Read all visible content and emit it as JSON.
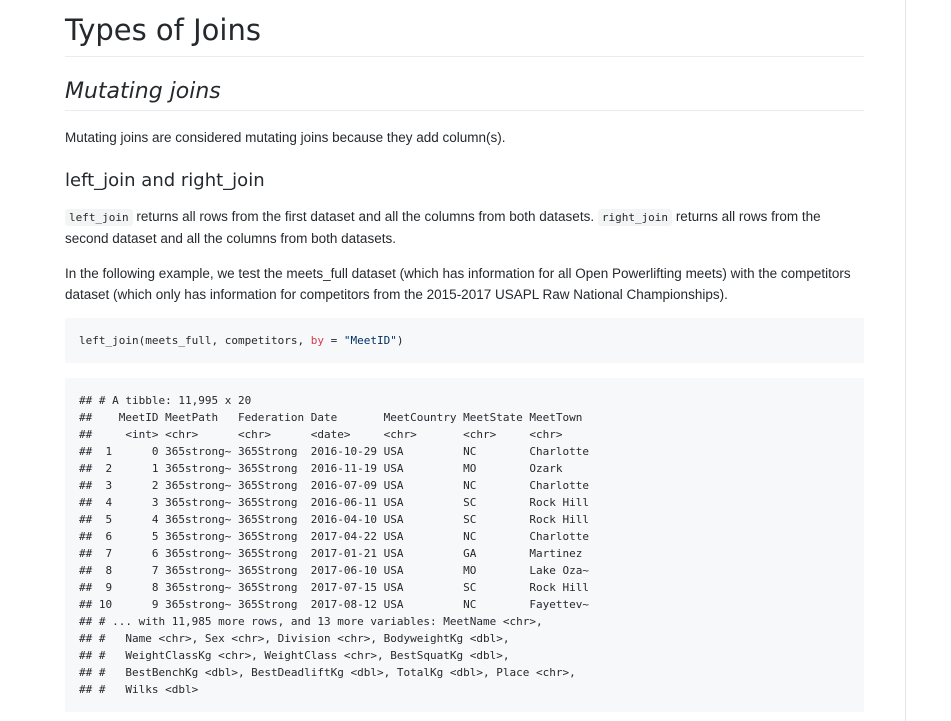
{
  "h1": "Types of Joins",
  "h2": "Mutating joins",
  "p1": "Mutating joins are considered mutating joins because they add column(s).",
  "h3": "left_join and right_join",
  "p2": {
    "code1": "left_join",
    "text1": " returns all rows from the first dataset and all the columns from both datasets. ",
    "code2": "right_join",
    "text2": " returns all rows from the second dataset and all the columns from both datasets."
  },
  "p3": "In the following example, we test the meets_full dataset (which has information for all Open Powerlifting meets) with the competitors dataset (which only has information for competitors from the 2015-2017 USAPL Raw National Championships).",
  "code": {
    "before": "left_join(meets_full, competitors, ",
    "kw": "by",
    "eq": " = ",
    "str": "\"MeetID\"",
    "after": ")"
  },
  "output_lines": [
    "## # A tibble: 11,995 x 20",
    "##    MeetID MeetPath   Federation Date       MeetCountry MeetState MeetTown",
    "##     <int> <chr>      <chr>      <date>     <chr>       <chr>     <chr>",
    "##  1      0 365strong~ 365Strong  2016-10-29 USA         NC        Charlotte",
    "##  2      1 365strong~ 365Strong  2016-11-19 USA         MO        Ozark",
    "##  3      2 365strong~ 365Strong  2016-07-09 USA         NC        Charlotte",
    "##  4      3 365strong~ 365Strong  2016-06-11 USA         SC        Rock Hill",
    "##  5      4 365strong~ 365Strong  2016-04-10 USA         SC        Rock Hill",
    "##  6      5 365strong~ 365Strong  2017-04-22 USA         NC        Charlotte",
    "##  7      6 365strong~ 365Strong  2017-01-21 USA         GA        Martinez",
    "##  8      7 365strong~ 365Strong  2017-06-10 USA         MO        Lake Oza~",
    "##  9      8 365strong~ 365Strong  2017-07-15 USA         SC        Rock Hill",
    "## 10      9 365strong~ 365Strong  2017-08-12 USA         NC        Fayettev~",
    "## # ... with 11,985 more rows, and 13 more variables: MeetName <chr>,",
    "## #   Name <chr>, Sex <chr>, Division <chr>, BodyweightKg <dbl>,",
    "## #   WeightClassKg <chr>, WeightClass <chr>, BestSquatKg <dbl>,",
    "## #   BestBenchKg <dbl>, BestDeadliftKg <dbl>, TotalKg <dbl>, Place <chr>,",
    "## #   Wilks <dbl>"
  ]
}
